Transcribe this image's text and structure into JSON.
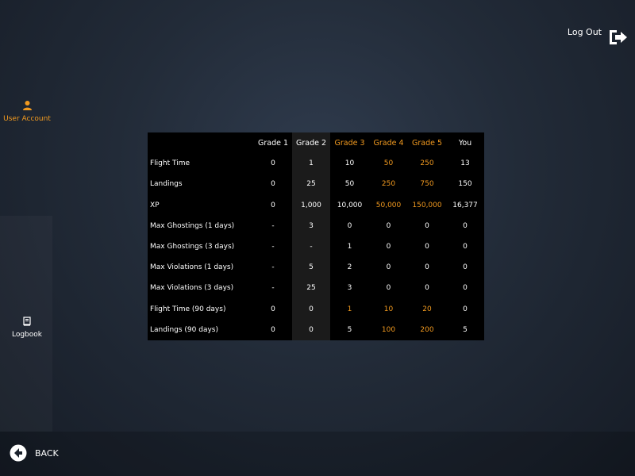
{
  "header": {
    "logout_label": "Log Out"
  },
  "sidebar": {
    "items": [
      {
        "label": "User Account",
        "icon": "user-icon",
        "active": true
      },
      {
        "label": "Logbook",
        "icon": "book-icon",
        "active": false
      }
    ]
  },
  "footer": {
    "back_label": "BACK"
  },
  "colors": {
    "accent": "#f29a1f",
    "table_bg": "#000000",
    "highlight_col": "#1b1b1b"
  },
  "table": {
    "columns": [
      "Grade 1",
      "Grade 2",
      "Grade 3",
      "Grade 4",
      "Grade 5",
      "You"
    ],
    "rows": [
      {
        "label": "Flight Time",
        "values": [
          "0",
          "1",
          "10",
          "50",
          "250",
          "13"
        ]
      },
      {
        "label": "Landings",
        "values": [
          "0",
          "25",
          "50",
          "250",
          "750",
          "150"
        ]
      },
      {
        "label": "XP",
        "values": [
          "0",
          "1,000",
          "10,000",
          "50,000",
          "150,000",
          "16,377"
        ]
      },
      {
        "label": "Max Ghostings (1 days)",
        "values": [
          "-",
          "3",
          "0",
          "0",
          "0",
          "0"
        ]
      },
      {
        "label": "Max Ghostings (3 days)",
        "values": [
          "-",
          "-",
          "1",
          "0",
          "0",
          "0"
        ]
      },
      {
        "label": "Max Violations (1 days)",
        "values": [
          "-",
          "5",
          "2",
          "0",
          "0",
          "0"
        ]
      },
      {
        "label": "Max Violations (3 days)",
        "values": [
          "-",
          "25",
          "3",
          "0",
          "0",
          "0"
        ]
      },
      {
        "label": "Flight Time (90 days)",
        "values": [
          "0",
          "0",
          "1",
          "10",
          "20",
          "0"
        ]
      },
      {
        "label": "Landings (90 days)",
        "values": [
          "0",
          "0",
          "5",
          "100",
          "200",
          "5"
        ]
      }
    ]
  }
}
